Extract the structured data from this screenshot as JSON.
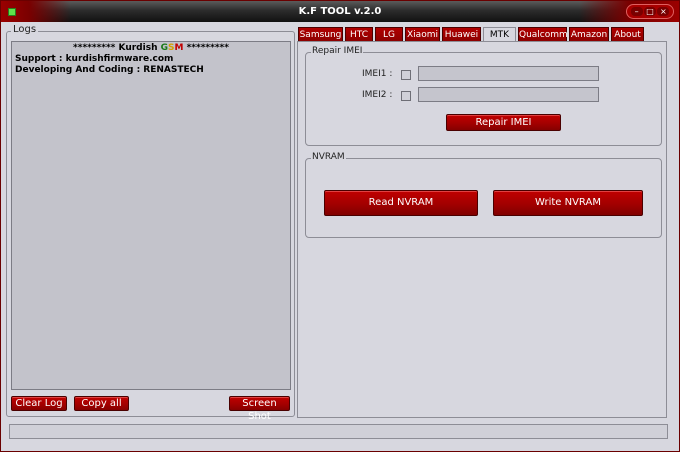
{
  "window": {
    "title": "K.F TOOL v.2.0",
    "controls": [
      "–",
      "□",
      "×"
    ]
  },
  "logs": {
    "legend": "Logs",
    "banner_prefix": "********* Kurdish ",
    "banner_g": "G",
    "banner_s": "S",
    "banner_m": "M",
    "banner_suffix": " *********",
    "lines": [
      "Support : kurdishfirmware.com",
      "Developing And Coding : RENASTECH"
    ],
    "buttons": {
      "clear_log": "Clear Log",
      "copy_all": "Copy all",
      "screen_shot": "Screen Shot"
    }
  },
  "tabs": [
    {
      "label": "Samsung",
      "active": false
    },
    {
      "label": "HTC",
      "active": false
    },
    {
      "label": "LG",
      "active": false
    },
    {
      "label": "Xiaomi",
      "active": false
    },
    {
      "label": "Huawei",
      "active": false
    },
    {
      "label": "MTK",
      "active": true
    },
    {
      "label": "Qualcomm",
      "active": false
    },
    {
      "label": "Amazon",
      "active": false
    },
    {
      "label": "About",
      "active": false
    }
  ],
  "repair_imei": {
    "legend": "Repair IMEI",
    "imei1_label": "IMEI1 :",
    "imei1_value": "",
    "imei2_label": "IMEI2 :",
    "imei2_value": "",
    "button": "Repair IMEI"
  },
  "nvram": {
    "legend": "NVRAM",
    "read_button": "Read NVRAM",
    "write_button": "Write NVRAM"
  },
  "status": {
    "text": ""
  }
}
